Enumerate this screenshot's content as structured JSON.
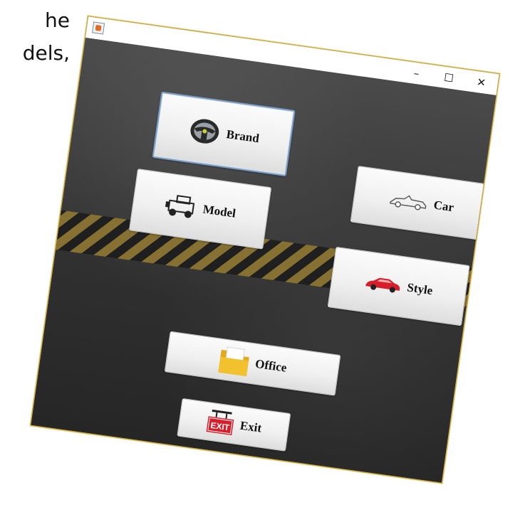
{
  "background_text": {
    "line1": "he",
    "line2": "dels,"
  },
  "window": {
    "controls": {
      "minimize": "–",
      "maximize": "☐",
      "close": "✕"
    }
  },
  "buttons": {
    "brand": "Brand",
    "car": "Car",
    "model": "Model",
    "style": "Style",
    "office": "Office",
    "exit": "Exit"
  },
  "icons": {
    "brand": "steering-wheel-icon",
    "car": "convertible-car-icon",
    "model": "jeep-icon",
    "style": "red-car-icon",
    "office": "folder-icon",
    "exit": "exit-sign-icon"
  },
  "colors": {
    "window_border": "#d9b441",
    "stripe_yellow": "#8a7432",
    "focus_border": "#7aa0c9",
    "style_car": "#d81e2a",
    "exit_sign": "#d81e2a",
    "folder": "#f2c12e"
  }
}
